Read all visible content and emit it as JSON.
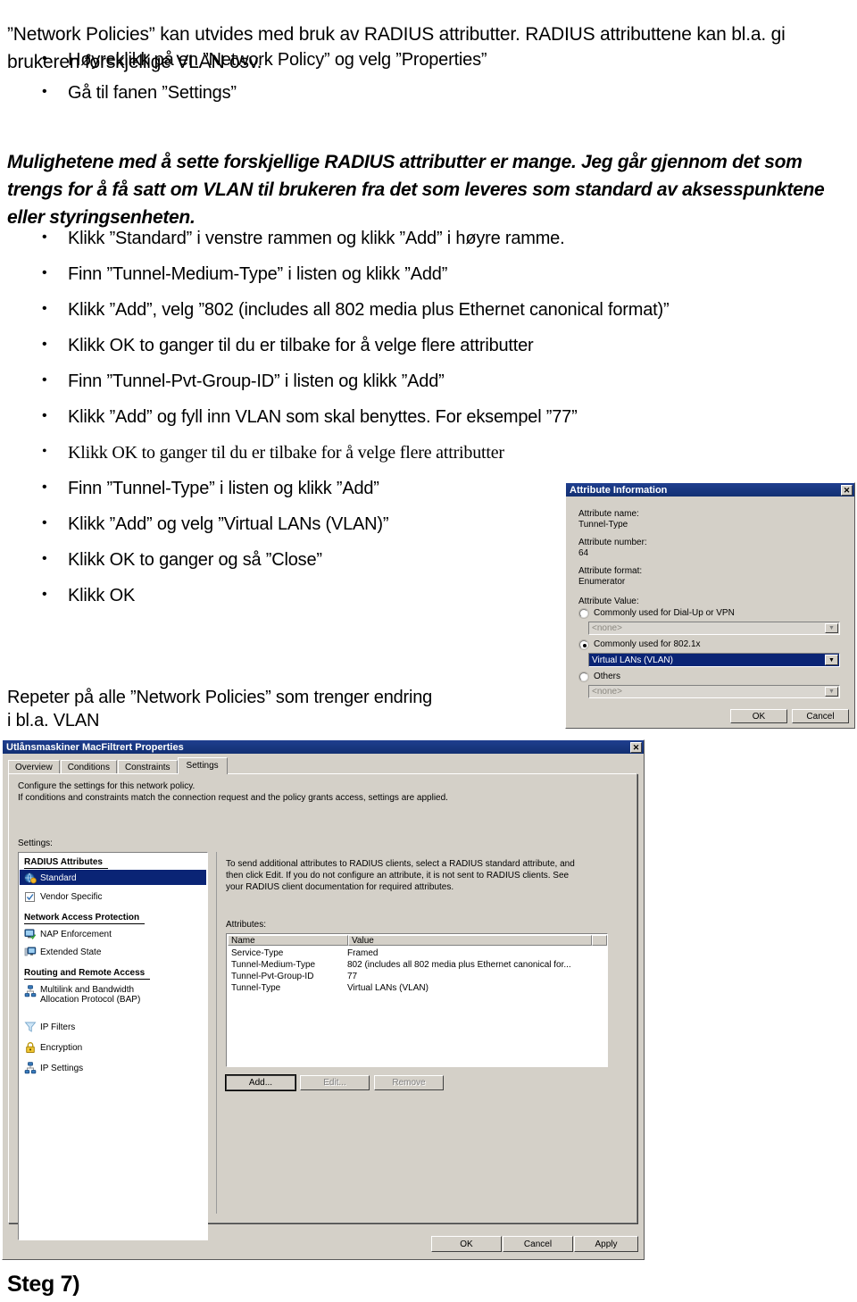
{
  "document": {
    "intro_paragraph": "”Network Policies” kan utvides med bruk av RADIUS attributter. RADIUS attributtene kan bl.a. gi brukeren forskjellige VLAN osv.",
    "first_bullets": [
      "Høyreklikk på en ”Network Policy” og velg ”Properties”",
      "Gå til fanen ”Settings”"
    ],
    "italic_paragraph": "Mulighetene med å sette forskjellige RADIUS attributter er mange. Jeg går gjennom det som trengs for å få satt om VLAN til brukeren fra det som leveres som standard av aksesspunktene eller styringsenheten.",
    "second_bullets": [
      "Klikk ”Standard” i venstre rammen og klikk ”Add” i høyre ramme.",
      "Finn ”Tunnel-Medium-Type” i listen og klikk ”Add”",
      "Klikk ”Add”, velg ”802 (includes all 802 media plus Ethernet canonical format)”",
      "Klikk OK to ganger til du er tilbake for å velge flere attributter",
      "Finn ”Tunnel-Pvt-Group-ID” i listen og klikk ”Add”",
      "Klikk ”Add” og fyll inn VLAN som skal benyttes. For eksempel ”77”",
      "Klikk OK to ganger til du er tilbake for å velge flere attributter",
      "Finn ”Tunnel-Type” i listen og klikk ”Add”",
      "Klikk ”Add” og velg ”Virtual LANs (VLAN)”",
      "Klikk OK to ganger og så ”Close”",
      "Klikk OK"
    ],
    "repeat_paragraph": "Repeter på alle ”Network Policies” som trenger endring\n i bl.a. VLAN",
    "footer_heading": "Steg 7)"
  },
  "attribute_dialog": {
    "title": "Attribute Information",
    "close_label": "✕",
    "labels": {
      "attribute_name": "Attribute name:",
      "attribute_number": "Attribute number:",
      "attribute_format": "Attribute format:",
      "attribute_value": "Attribute Value:"
    },
    "values": {
      "attribute_name": "Tunnel-Type",
      "attribute_number": "64",
      "attribute_format": "Enumerator"
    },
    "options": {
      "dialup": "Commonly used for Dial-Up or VPN",
      "dot1x": "Commonly used for 802.1x",
      "others": "Others"
    },
    "combos": {
      "dialup_value": "<none>",
      "dot1x_value": "Virtual LANs (VLAN)",
      "others_value": "<none>",
      "arrow": "▼"
    },
    "buttons": {
      "ok": "OK",
      "cancel": "Cancel"
    },
    "accent_selection": "#0a2475"
  },
  "properties_dialog": {
    "title": "Utlånsmaskiner MacFiltrert Properties",
    "close_label": "✕",
    "tabs": [
      {
        "label": "Overview",
        "active": false
      },
      {
        "label": "Conditions",
        "active": false
      },
      {
        "label": "Constraints",
        "active": false
      },
      {
        "label": "Settings",
        "active": true
      }
    ],
    "description_line1": "Configure the settings for this network policy.",
    "description_line2": "If conditions and constraints match the connection request and the policy grants access, settings are applied.",
    "settings_label": "Settings:",
    "tree": [
      {
        "type": "header",
        "label": "RADIUS Attributes"
      },
      {
        "type": "item",
        "label": "Standard",
        "icon": "globe-icon",
        "selected": true
      },
      {
        "type": "item",
        "label": "Vendor Specific",
        "icon": "checkbox-icon",
        "selected": false
      },
      {
        "type": "header",
        "label": "Network Access Protection"
      },
      {
        "type": "item",
        "label": "NAP Enforcement",
        "icon": "monitor-check-icon",
        "selected": false
      },
      {
        "type": "item",
        "label": "Extended State",
        "icon": "monitor-state-icon",
        "selected": false
      },
      {
        "type": "header",
        "label": "Routing and Remote Access"
      },
      {
        "type": "item",
        "label": "Multilink and Bandwidth",
        "label2": "Allocation Protocol (BAP)",
        "icon": "network-nodes-icon",
        "selected": false
      },
      {
        "type": "item",
        "label": "IP Filters",
        "icon": "funnel-icon",
        "selected": false
      },
      {
        "type": "item",
        "label": "Encryption",
        "icon": "lock-icon",
        "selected": false
      },
      {
        "type": "item",
        "label": "IP Settings",
        "icon": "network-nodes-icon",
        "selected": false
      }
    ],
    "panel_text_line1": "To send additional attributes to RADIUS clients, select a RADIUS standard attribute, and",
    "panel_text_line2": "then click Edit. If you do not configure an attribute, it is not sent to RADIUS clients. See",
    "panel_text_line3": "your RADIUS client documentation for required attributes.",
    "attributes_label": "Attributes:",
    "table": {
      "columns": [
        "Name",
        "Value"
      ],
      "rows": [
        {
          "name": "Service-Type",
          "value": "Framed"
        },
        {
          "name": "Tunnel-Medium-Type",
          "value": "802 (includes all 802 media plus Ethernet canonical for..."
        },
        {
          "name": "Tunnel-Pvt-Group-ID",
          "value": "77"
        },
        {
          "name": "Tunnel-Type",
          "value": "Virtual LANs (VLAN)"
        }
      ]
    },
    "list_buttons": {
      "add": "Add...",
      "edit": "Edit...",
      "remove": "Remove"
    },
    "footer_buttons": {
      "ok": "OK",
      "cancel": "Cancel",
      "apply": "Apply"
    }
  }
}
